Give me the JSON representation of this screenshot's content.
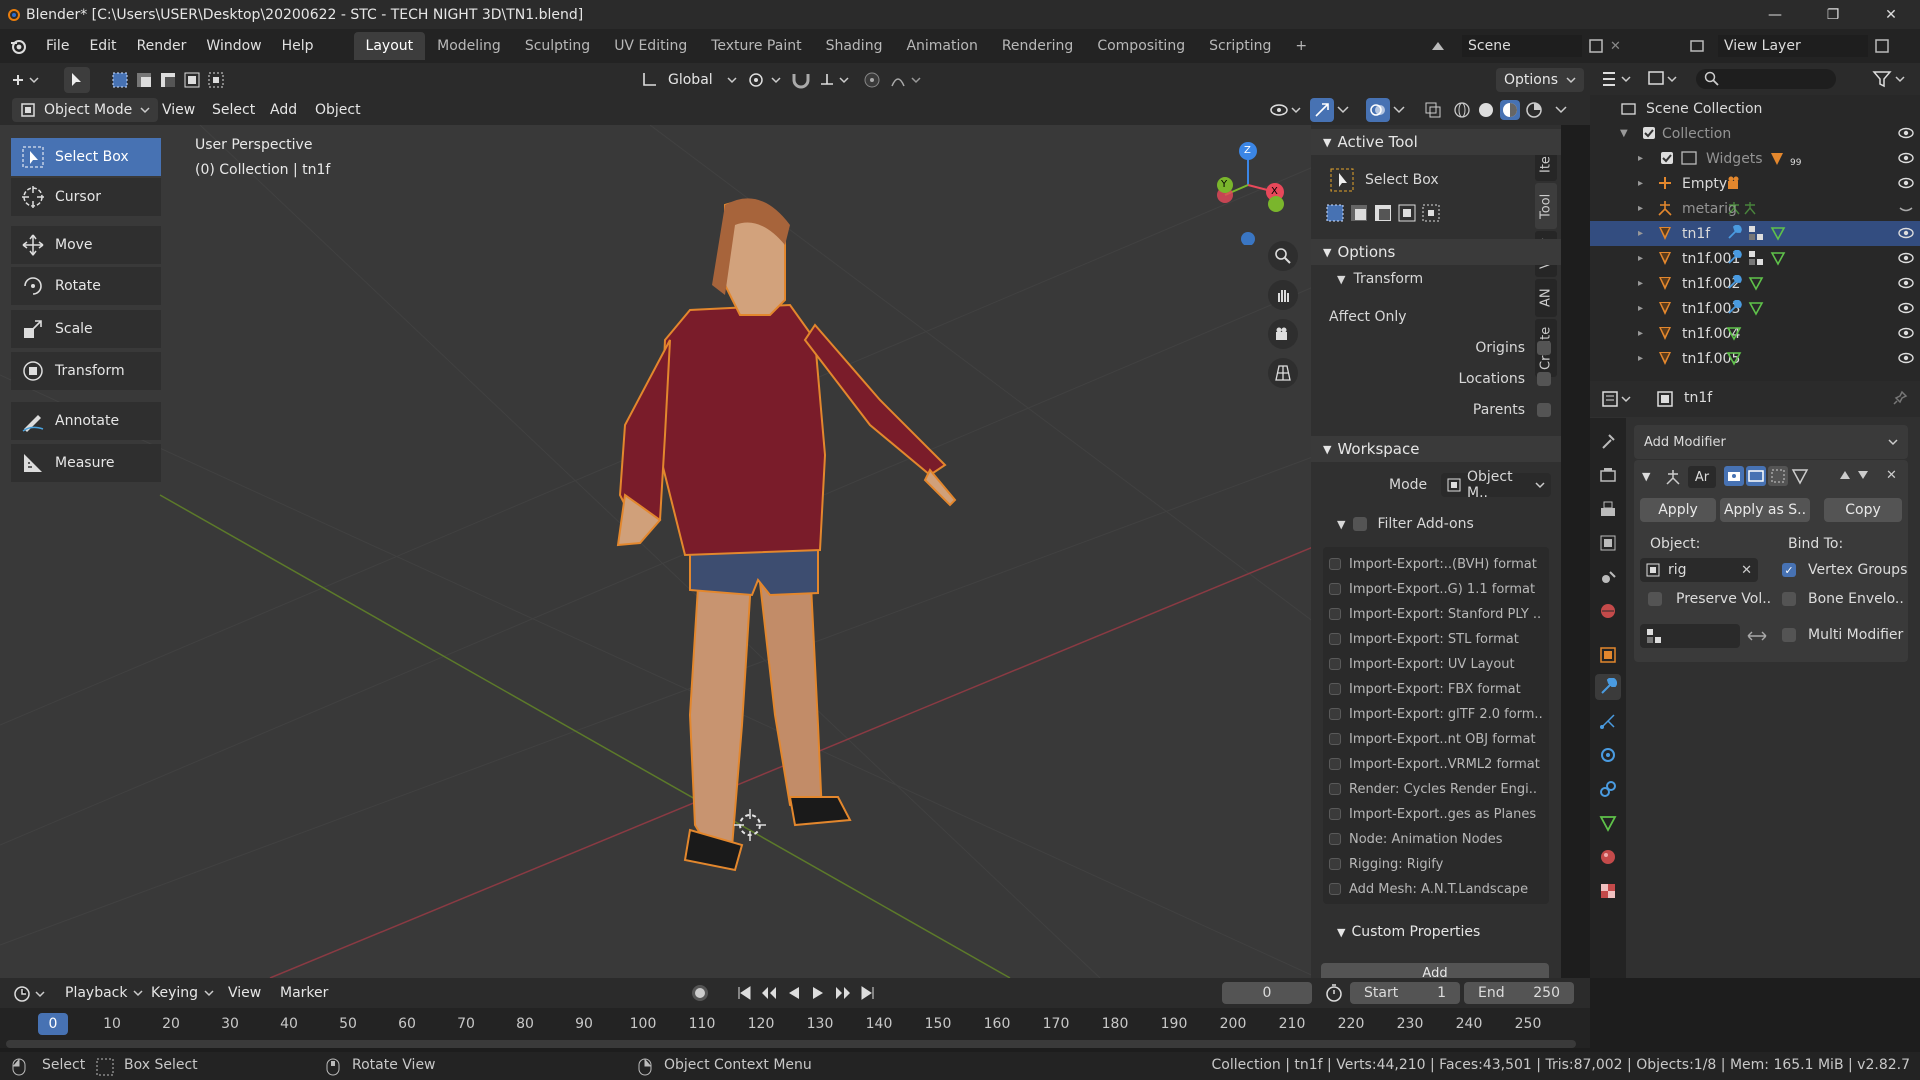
{
  "window": {
    "title": "Blender* [C:\\Users\\USER\\Desktop\\20200622 - STC - TECH NIGHT 3D\\TN1.blend]",
    "minimize": "—",
    "maximize": "❐",
    "close": "✕"
  },
  "menu": {
    "items": [
      "File",
      "Edit",
      "Render",
      "Window",
      "Help"
    ],
    "workspaces": [
      "Layout",
      "Modeling",
      "Sculpting",
      "UV Editing",
      "Texture Paint",
      "Shading",
      "Animation",
      "Rendering",
      "Compositing",
      "Scripting"
    ],
    "add_tab": "+",
    "scene": "Scene",
    "view_layer": "View Layer"
  },
  "header": {
    "transform_orientation": "Global",
    "options": "Options",
    "mode": "Object Mode",
    "menus": [
      "View",
      "Select",
      "Add",
      "Object"
    ]
  },
  "viewport": {
    "perspective": "User Perspective",
    "collection_info": "(0) Collection | tn1f",
    "gizmo_axes": {
      "z": "Z",
      "y": "Y",
      "x": "X"
    }
  },
  "tools": [
    "Select Box",
    "Cursor",
    "Move",
    "Rotate",
    "Scale",
    "Transform",
    "Annotate",
    "Measure"
  ],
  "sidebar": {
    "tabs": [
      "Item",
      "Tool",
      "View",
      "AN",
      "Create"
    ],
    "active_tool_header": "Active Tool",
    "active_tool": "Select Box",
    "options_header": "Options",
    "transform_header": "Transform",
    "affect_only": "Affect Only",
    "affect": [
      {
        "label": "Origins",
        "checked": false
      },
      {
        "label": "Locations",
        "checked": false
      },
      {
        "label": "Parents",
        "checked": false
      }
    ],
    "workspace_header": "Workspace",
    "mode_label": "Mode",
    "mode_value": "Object M..",
    "filter_addons": "Filter Add-ons",
    "addons": [
      "Import-Export:..(BVH) format",
      "Import-Export..G) 1.1 format",
      "Import-Export: Stanford PLY ..",
      "Import-Export: STL format",
      "Import-Export: UV Layout",
      "Import-Export: FBX format",
      "Import-Export: glTF 2.0 form..",
      "Import-Export..nt OBJ format",
      "Import-Export..VRML2 format",
      "Render: Cycles Render Engi..",
      "Import-Export..ges as Planes",
      "Node: Animation Nodes",
      "Rigging: Rigify",
      "Add Mesh: A.N.T.Landscape"
    ],
    "custom_props_header": "Custom Properties",
    "add_button": "Add"
  },
  "outliner": {
    "root": "Scene Collection",
    "items": [
      {
        "name": "Collection",
        "indent": 1,
        "selected": false,
        "dim": true,
        "badge": ""
      },
      {
        "name": "Widgets",
        "indent": 2,
        "selected": false,
        "dim": true,
        "badge": "99"
      },
      {
        "name": "Empty",
        "indent": 2,
        "selected": false,
        "dim": false,
        "badge": ""
      },
      {
        "name": "metarig",
        "indent": 2,
        "selected": false,
        "dim": true,
        "badge": ""
      },
      {
        "name": "tn1f",
        "indent": 2,
        "selected": true,
        "dim": false,
        "badge": ""
      },
      {
        "name": "tn1f.001",
        "indent": 2,
        "selected": false,
        "dim": false,
        "badge": ""
      },
      {
        "name": "tn1f.002",
        "indent": 2,
        "selected": false,
        "dim": false,
        "badge": ""
      },
      {
        "name": "tn1f.003",
        "indent": 2,
        "selected": false,
        "dim": false,
        "badge": ""
      },
      {
        "name": "tn1f.004",
        "indent": 2,
        "selected": false,
        "dim": false,
        "badge": ""
      },
      {
        "name": "tn1f.005",
        "indent": 2,
        "selected": false,
        "dim": false,
        "badge": ""
      }
    ]
  },
  "properties": {
    "object_name": "tn1f",
    "add_modifier": "Add Modifier",
    "modifier_name": "Ar",
    "apply": "Apply",
    "apply_as": "Apply as S..",
    "copy": "Copy",
    "object_label": "Object:",
    "object_value": "rig",
    "bind_to": "Bind To:",
    "vertex_groups": "Vertex Groups",
    "preserve_vol": "Preserve Vol..",
    "bone_envelopes": "Bone Envelo..",
    "multi_modifier": "Multi Modifier"
  },
  "timeline": {
    "menus": [
      "Playback",
      "Keying",
      "View",
      "Marker"
    ],
    "current_frame": "0",
    "start_label": "Start",
    "start_value": "1",
    "end_label": "End",
    "end_value": "250",
    "ticks": [
      "0",
      "10",
      "20",
      "30",
      "40",
      "50",
      "60",
      "70",
      "80",
      "90",
      "100",
      "110",
      "120",
      "130",
      "140",
      "150",
      "160",
      "170",
      "180",
      "190",
      "200",
      "210",
      "220",
      "230",
      "240",
      "250"
    ]
  },
  "status": {
    "select": "Select",
    "box_select": "Box Select",
    "rotate_view": "Rotate View",
    "context_menu": "Object Context Menu",
    "stats": "Collection | tn1f | Verts:44,210 | Faces:43,501 | Tris:87,002 | Objects:1/8 | Mem: 165.1 MiB | v2.82.7"
  },
  "colors": {
    "accent": "#4772b3",
    "selection": "#334d80",
    "mesh_orange": "#e3872d",
    "axis_x": "#e8485a",
    "axis_y": "#7ab62c",
    "axis_z": "#3b86e6"
  }
}
